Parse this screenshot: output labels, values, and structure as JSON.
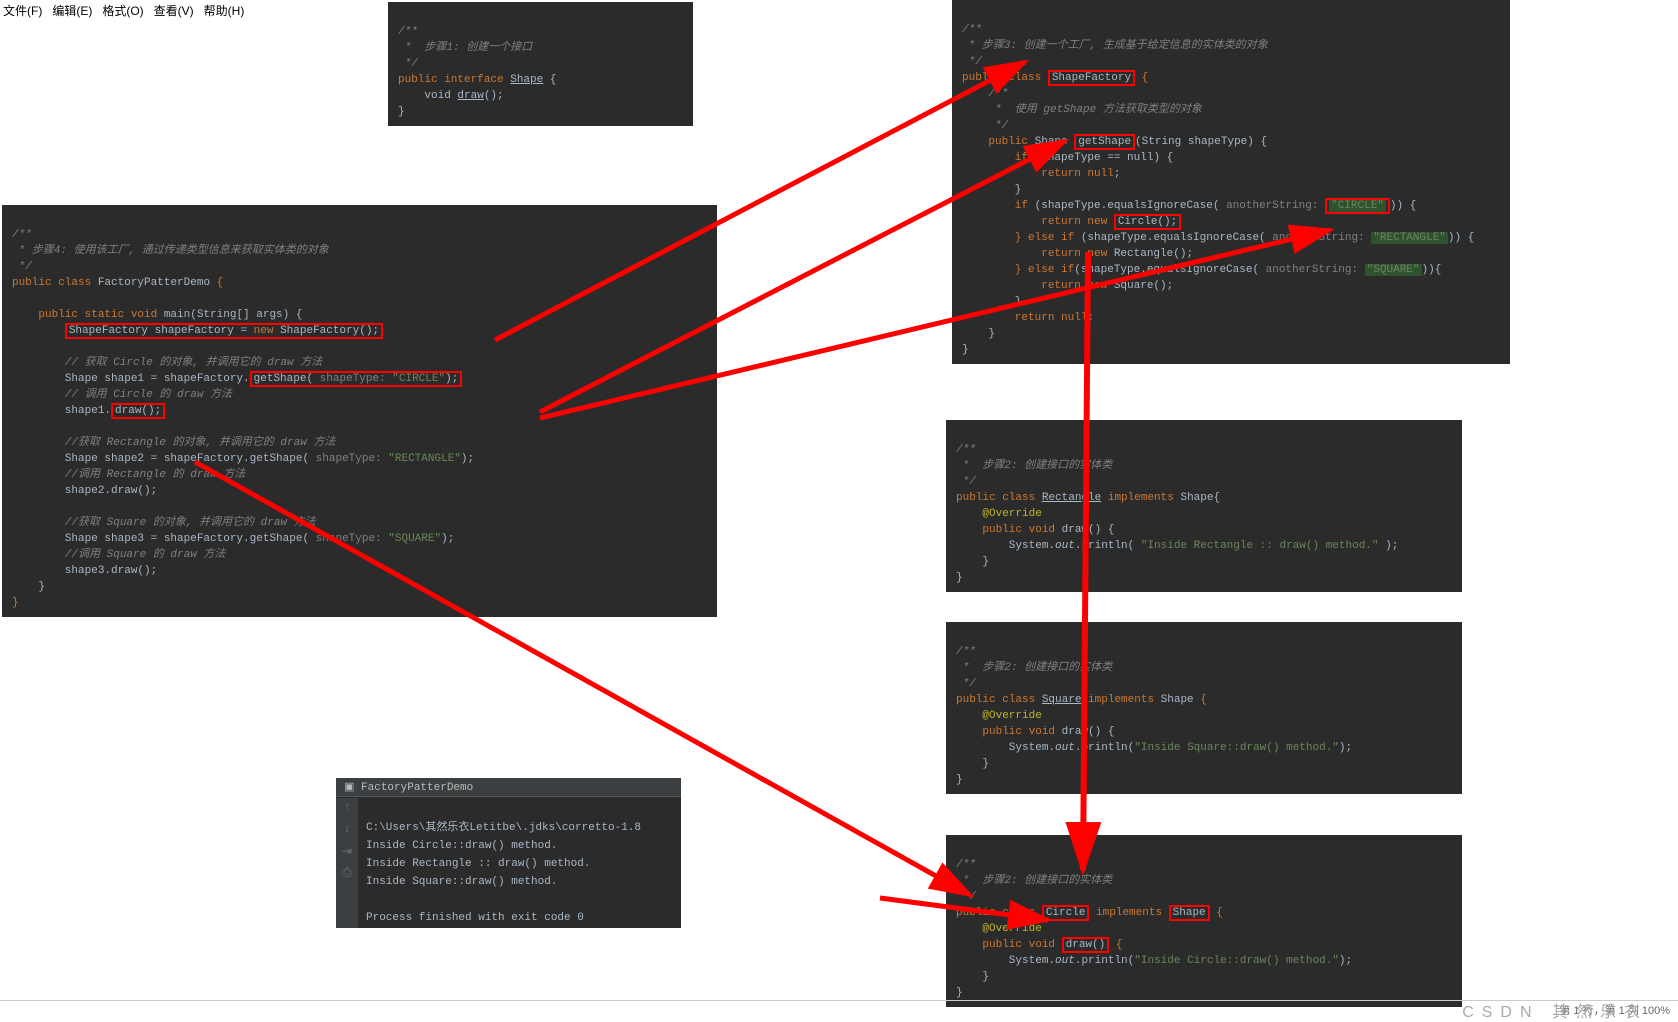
{
  "menu": [
    "文件(F)",
    "编辑(E)",
    "格式(O)",
    "查看(V)",
    "帮助(H)"
  ],
  "panel1": {
    "c1": "/**",
    "c2": " *  步骤1: 创建一个接口",
    "c3": " */",
    "l1_a": "public interface",
    "l1_b": "Shape",
    "l1_c": " {",
    "l2_a": "    void ",
    "l2_b": "draw",
    "l2_c": "();",
    "l3": "}"
  },
  "panel2": {
    "c1": "/**",
    "c2": " * 步骤4: 使用该工厂, 通过传递类型信息来获取实体类的对象",
    "c3": " */",
    "l1_a": "public class ",
    "l1_b": "FactoryPatterDemo ",
    "l1_c": "{",
    "l3_a": "    public static void ",
    "l3_b": "main",
    "l3_c": "(String[] args) {",
    "l4": "        ShapeFactory shapeFactory = new ShapeFactory();",
    "l4_new": "new",
    "c5": "        // 获取 Circle 的对象, 并调用它的 draw 方法",
    "l6_a": "        Shape shape1 = shapeFactory.",
    "l6_b": "getShape(",
    "l6_hint": " shapeType: ",
    "l6_c": "\"CIRCLE\"",
    "l6_d": ");",
    "c7": "        // 调用 Circle 的 draw 方法",
    "l8_a": "        shape1.",
    "l8_b": "draw();",
    "c10": "        //获取 Rectangle 的对象, 并调用它的 draw 方法",
    "l11_a": "        Shape shape2 = shapeFactory.getShape(",
    "l11_hint": " shapeType: ",
    "l11_b": "\"RECTANGLE\"",
    "l11_c": ");",
    "c12": "        //调用 Rectangle 的 draw 方法",
    "l13": "        shape2.draw();",
    "c15": "        //获取 Square 的对象, 并调用它的 draw 方法",
    "l16_a": "        Shape shape3 = shapeFactory.getShape(",
    "l16_hint": " shapeType: ",
    "l16_b": "\"SQUARE\"",
    "l16_c": ");",
    "c17": "        //调用 Square 的 draw 方法",
    "l18": "        shape3.draw();",
    "l19": "    }",
    "l20": "}"
  },
  "console": {
    "tab_icon": "▣",
    "tab": "FactoryPatterDemo",
    "l0": "C:\\Users\\其然乐衣Letitbe\\.jdks\\corretto-1.8",
    "l1": "Inside Circle::draw() method.",
    "l2": "Inside Rectangle :: draw() method.",
    "l3": "Inside Square::draw() method.",
    "l5": "Process finished with exit code 0"
  },
  "panel3": {
    "c1": "/**",
    "c2": " * 步骤3: 创建一个工厂, 生成基于给定信息的实体类的对象",
    "c3": " */",
    "l1_a": "public class ",
    "l1_b": "ShapeFactory",
    "l1_c": " {",
    "cc1": "    /**",
    "cc2": "     *  使用 getShape 方法获取类型的对象",
    "cc3": "     */",
    "l2_a": "    public ",
    "l2_b": "Shape ",
    "l2_c": "getShape",
    "l2_d": "(String shapeType) {",
    "l3_a": "        if ",
    "l3_b": "(shapeType == null) {",
    "l4_a": "            return null",
    "l4_b": ";",
    "l5": "        }",
    "l6_a": "        if ",
    "l6_b": "(shapeType.equalsIgnoreCase(",
    "l6_hint": " anotherString: ",
    "l6_c": "\"CIRCLE\"",
    "l6_d": ")) {",
    "l7_a": "            return new ",
    "l7_b": "Circle();",
    "l8_a": "        } else if ",
    "l8_b": "(shapeType.equalsIgnoreCase(",
    "l8_hint": " anotherString: ",
    "l8_c": "\"RECTANGLE\"",
    "l8_d": ")) {",
    "l9_a": "            return new ",
    "l9_b": "Rectangle();",
    "l10_a": "        } else if",
    "l10_b": "(shapeType.equalsIgnoreCase(",
    "l10_hint": " anotherString: ",
    "l10_c": "\"SQUARE\"",
    "l10_d": ")){",
    "l11_a": "            return new ",
    "l11_b": "Square();",
    "l12": "        }",
    "l13_a": "        return null",
    "l13_b": ";",
    "l14": "    }",
    "l15": "}"
  },
  "panel4": {
    "c1": "/**",
    "c2": " *  步骤2: 创建接口的实体类",
    "c3": " */",
    "l1_a": "public class ",
    "l1_b": "Rectangle",
    "l1_c": " implements ",
    "l1_d": "Shape",
    "l1_e": "{",
    "l2": "    @Override",
    "l3_a": "    public void ",
    "l3_b": "draw",
    "l3_c": "() {",
    "l4_a": "        System.",
    "l4_b": "out",
    "l4_c": ".println( ",
    "l4_d": "\"Inside Rectangle :: draw() method.\"",
    "l4_e": " );",
    "l5": "    }",
    "l6": "}"
  },
  "panel5": {
    "c1": "/**",
    "c2": " *  步骤2: 创建接口的实体类",
    "c3": " */",
    "l1_a": "public class ",
    "l1_b": "Square",
    "l1_c": " implements ",
    "l1_d": "Shape ",
    "l1_e": "{",
    "l2": "    @Override",
    "l3_a": "    public void ",
    "l3_b": "draw",
    "l3_c": "() {",
    "l4_a": "        System.",
    "l4_b": "out",
    "l4_c": ".println(",
    "l4_d": "\"Inside Square::draw() method.\"",
    "l4_e": ");",
    "l5": "    }",
    "l6": "}"
  },
  "panel6": {
    "c1": "/**",
    "c2": " *  步骤2: 创建接口的实体类",
    "c3": " */",
    "l1_a": "public class ",
    "l1_b": "Circle",
    "l1_c": " implements ",
    "l1_d": "Shape",
    "l1_e": " {",
    "l2": "    @Override",
    "l3_a": "    public void ",
    "l3_b": "draw()",
    "l3_c": " {",
    "l4_a": "        System.",
    "l4_b": "out",
    "l4_c": ".println(",
    "l4_d": "\"Inside Circle::draw() method.\"",
    "l4_e": ");",
    "l5": "    }",
    "l6": "}"
  },
  "status": "第 1 行，第 1 列    100%",
  "watermark": "CSDN 其然乐衣"
}
